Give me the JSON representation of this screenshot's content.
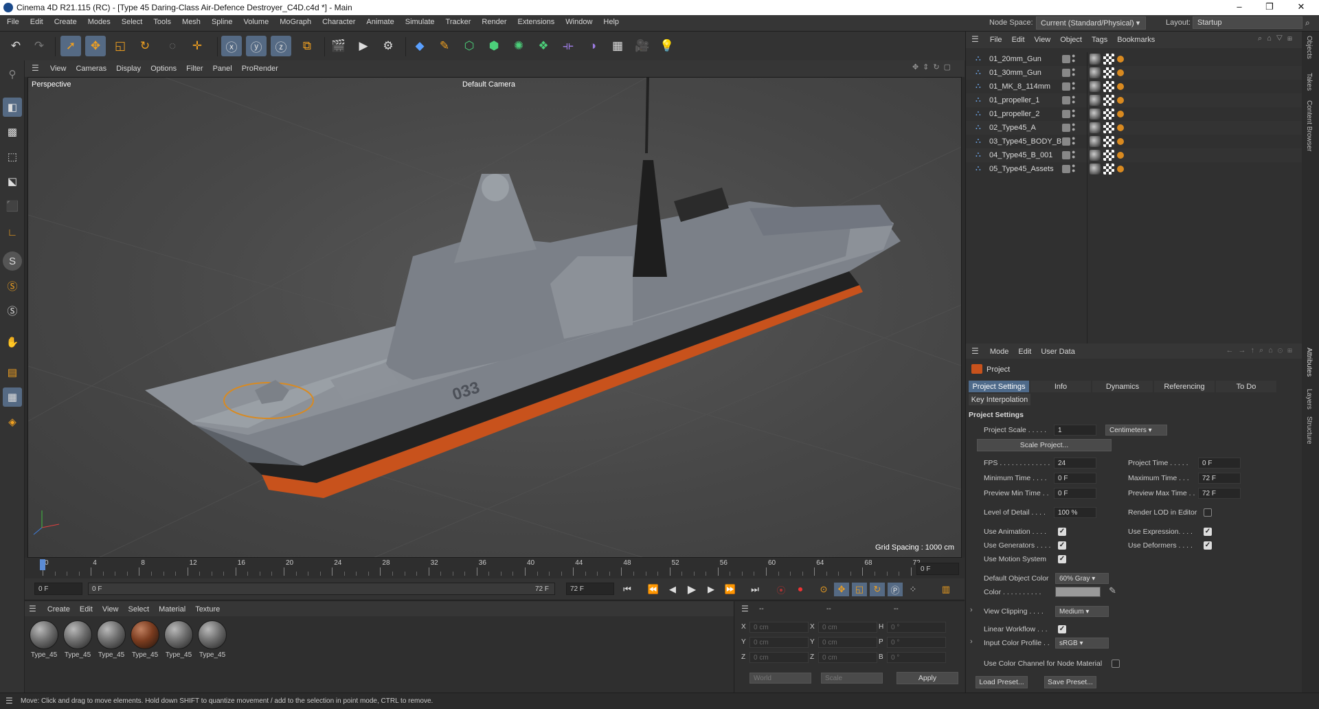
{
  "window": {
    "title": "Cinema 4D R21.115 (RC) - [Type 45 Daring-Class Air-Defence Destroyer_C4D.c4d *] - Main"
  },
  "menu": [
    "File",
    "Edit",
    "Create",
    "Modes",
    "Select",
    "Tools",
    "Mesh",
    "Spline",
    "Volume",
    "MoGraph",
    "Character",
    "Animate",
    "Simulate",
    "Tracker",
    "Render",
    "Extensions",
    "Window",
    "Help"
  ],
  "nodespace": {
    "label": "Node Space:",
    "value": "Current (Standard/Physical)"
  },
  "layout": {
    "label": "Layout:",
    "value": "Startup"
  },
  "viewport": {
    "menu": [
      "View",
      "Cameras",
      "Display",
      "Options",
      "Filter",
      "Panel",
      "ProRender"
    ],
    "label": "Perspective",
    "camera": "Default Camera",
    "grid": "Grid Spacing : 1000 cm",
    "hull_number": "033"
  },
  "timeline": {
    "ticks": [
      "0",
      "4",
      "8",
      "12",
      "16",
      "20",
      "24",
      "28",
      "32",
      "36",
      "40",
      "44",
      "48",
      "52",
      "56",
      "60",
      "64",
      "68",
      "72"
    ],
    "current": "0 F",
    "start": "0 F",
    "range_start": "0 F",
    "range_end": "72 F",
    "end": "72 F"
  },
  "materials": {
    "menu": [
      "Create",
      "Edit",
      "View",
      "Select",
      "Material",
      "Texture"
    ],
    "items": [
      "Type_45",
      "Type_45",
      "Type_45",
      "Type_45",
      "Type_45",
      "Type_45"
    ]
  },
  "coords": {
    "header": [
      "--",
      "--",
      "--"
    ],
    "rows": [
      {
        "a": "X",
        "av": "0 cm",
        "b": "X",
        "bv": "0 cm",
        "c": "H",
        "cv": "0 °"
      },
      {
        "a": "Y",
        "av": "0 cm",
        "b": "Y",
        "bv": "0 cm",
        "c": "P",
        "cv": "0 °"
      },
      {
        "a": "Z",
        "av": "0 cm",
        "b": "Z",
        "bv": "0 cm",
        "c": "B",
        "cv": "0 °"
      }
    ],
    "world": "World",
    "scale": "Scale",
    "apply": "Apply"
  },
  "status": "Move: Click and drag to move elements. Hold down SHIFT to quantize movement / add to the selection in point mode, CTRL to remove.",
  "objects": {
    "menu": [
      "File",
      "Edit",
      "View",
      "Object",
      "Tags",
      "Bookmarks"
    ],
    "items": [
      "01_20mm_Gun",
      "01_30mm_Gun",
      "01_MK_8_114mm",
      "01_propeller_1",
      "01_propeller_2",
      "02_Type45_A",
      "03_Type45_BODY_B",
      "04_Type45_B_001",
      "05_Type45_Assets"
    ]
  },
  "attributes": {
    "menu": [
      "Mode",
      "Edit",
      "User Data"
    ],
    "title": "Project",
    "tabs": [
      "Project Settings",
      "Info",
      "Dynamics",
      "Referencing",
      "To Do"
    ],
    "tab2": "Key Interpolation",
    "section": "Project Settings",
    "project_scale": {
      "label": "Project Scale . . . . .",
      "value": "1",
      "unit": "Centimeters"
    },
    "scale_btn": "Scale Project...",
    "fps": {
      "label": "FPS . . . . . . . . . . . . .",
      "value": "24"
    },
    "project_time": {
      "label": "Project Time . . . . .",
      "value": "0 F"
    },
    "min_time": {
      "label": "Minimum Time . . . .",
      "value": "0 F"
    },
    "max_time": {
      "label": "Maximum Time . . .",
      "value": "72 F"
    },
    "prev_min": {
      "label": "Preview Min Time . .",
      "value": "0 F"
    },
    "prev_max": {
      "label": "Preview Max Time . .",
      "value": "72 F"
    },
    "lod": {
      "label": "Level of Detail . . . .",
      "value": "100 %"
    },
    "render_lod": "Render LOD in Editor",
    "use_animation": "Use Animation . . . .",
    "use_expression": "Use Expression. . . .",
    "use_generators": "Use Generators . . . .",
    "use_deformers": "Use Deformers . . . .",
    "use_motion": "Use Motion System",
    "def_color": {
      "label": "Default Object Color",
      "value": "60% Gray"
    },
    "color": "Color . . . . . . . . . .",
    "view_clipping": {
      "label": "View Clipping . . . .",
      "value": "Medium"
    },
    "linear_workflow": "Linear Workflow . . .",
    "input_profile": {
      "label": "Input Color Profile . .",
      "value": "sRGB"
    },
    "color_channel": "Use Color Channel for Node Material",
    "load_preset": "Load Preset...",
    "save_preset": "Save Preset..."
  },
  "side_tabs": [
    "Objects",
    "Takes",
    "Content Browser",
    "Attributes",
    "Layers",
    "Structure"
  ],
  "colors": {
    "accent": "#4e6a8a",
    "hull": "#8a8f96",
    "boot": "#c8521c"
  }
}
